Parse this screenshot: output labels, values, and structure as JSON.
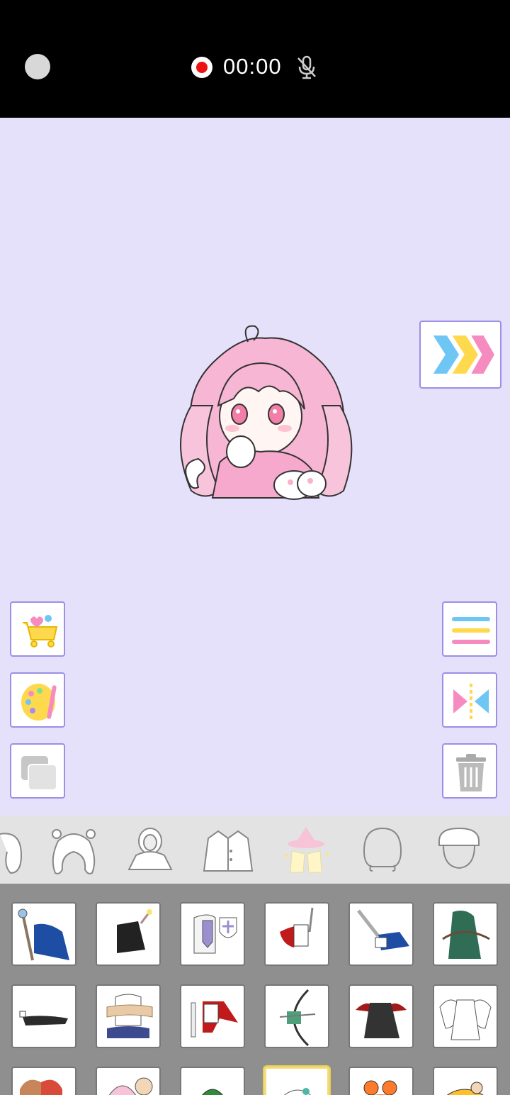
{
  "status_bar": {
    "timer": "00:00",
    "recording_icon": "record-icon",
    "mic_icon": "mic-off-icon"
  },
  "stage": {
    "background": "#e6e1fb",
    "character": "chibi-girl-pink-twintails"
  },
  "left_tools": [
    "shop-cart-icon",
    "palette-icon",
    "layers-icon"
  ],
  "right_tools": [
    "menu-icon",
    "flip-icon",
    "trash-icon"
  ],
  "next_button": "next-chevrons-icon",
  "categories": [
    "hair-partial",
    "hair-twintails",
    "hoodie",
    "jacket",
    "costume-set",
    "head-outline",
    "hat-cap"
  ],
  "selected_category": "costume-set",
  "items_selected_index": 15,
  "colors": {
    "accent_border": "#9b8fe6",
    "pink": "#f58bbf",
    "blue": "#6ec6f5",
    "yellow": "#ffd94d"
  }
}
